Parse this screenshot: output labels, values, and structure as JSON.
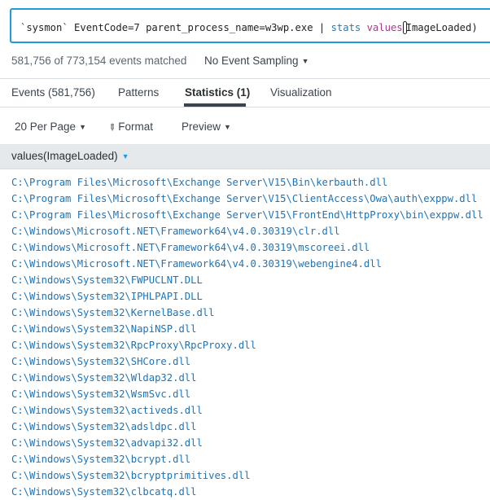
{
  "search": {
    "query_prefix": "`sysmon` EventCode=7 parent_process_name=w3wp.exe | ",
    "query_cmd": "stats",
    "query_space": " ",
    "query_fn": "values",
    "query_suffix": "ImageLoaded)"
  },
  "status": {
    "events_matched": "581,756 of 773,154 events matched",
    "sampling": "No Event Sampling"
  },
  "tabs": [
    {
      "label": "Events (581,756)"
    },
    {
      "label": "Patterns"
    },
    {
      "label": "Statistics (1)",
      "active": true
    },
    {
      "label": "Visualization"
    }
  ],
  "toolbar": {
    "per_page": "20 Per Page",
    "format": "Format",
    "preview": "Preview"
  },
  "table": {
    "column_header": "values(ImageLoaded)",
    "rows": [
      "C:\\Program Files\\Microsoft\\Exchange Server\\V15\\Bin\\kerbauth.dll",
      "C:\\Program Files\\Microsoft\\Exchange Server\\V15\\ClientAccess\\Owa\\auth\\exppw.dll",
      "C:\\Program Files\\Microsoft\\Exchange Server\\V15\\FrontEnd\\HttpProxy\\bin\\exppw.dll",
      "C:\\Windows\\Microsoft.NET\\Framework64\\v4.0.30319\\clr.dll",
      "C:\\Windows\\Microsoft.NET\\Framework64\\v4.0.30319\\mscoreei.dll",
      "C:\\Windows\\Microsoft.NET\\Framework64\\v4.0.30319\\webengine4.dll",
      "C:\\Windows\\System32\\FWPUCLNT.DLL",
      "C:\\Windows\\System32\\IPHLPAPI.DLL",
      "C:\\Windows\\System32\\KernelBase.dll",
      "C:\\Windows\\System32\\NapiNSP.dll",
      "C:\\Windows\\System32\\RpcProxy\\RpcProxy.dll",
      "C:\\Windows\\System32\\SHCore.dll",
      "C:\\Windows\\System32\\Wldap32.dll",
      "C:\\Windows\\System32\\WsmSvc.dll",
      "C:\\Windows\\System32\\activeds.dll",
      "C:\\Windows\\System32\\adsldpc.dll",
      "C:\\Windows\\System32\\advapi32.dll",
      "C:\\Windows\\System32\\bcrypt.dll",
      "C:\\Windows\\System32\\bcryptprimitives.dll",
      "C:\\Windows\\System32\\clbcatq.dll"
    ]
  },
  "colors": {
    "accent": "#1a9ce0",
    "link": "#1a75bc",
    "command": "#1f7bc1",
    "function": "#b4318f",
    "header_bg": "#e6e9ec"
  },
  "icons": {
    "sampling_caret": "chevron-down-icon",
    "format_icon": "pencil-icon",
    "sort_caret": "chevron-down-icon"
  }
}
